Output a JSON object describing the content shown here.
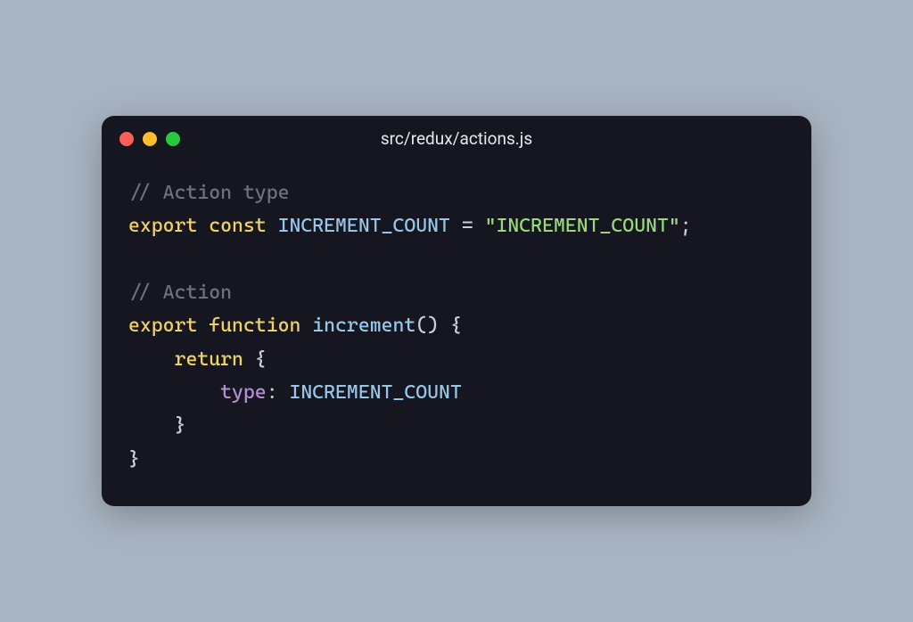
{
  "window": {
    "title": "src/redux/actions.js",
    "trafficLights": {
      "red": "#ff5f56",
      "yellow": "#ffbd2e",
      "green": "#27c93f"
    }
  },
  "code": {
    "comment1": "// Action type",
    "line2": {
      "kw_export": "export",
      "kw_const": "const",
      "ident": "INCREMENT_COUNT",
      "eq": " = ",
      "string": "\"INCREMENT_COUNT\"",
      "semi": ";"
    },
    "comment2": "// Action",
    "line4": {
      "kw_export": "export",
      "kw_function": "function",
      "fn_name": "increment",
      "parens": "()",
      "brace_open": " {"
    },
    "line5": {
      "indent": "    ",
      "kw_return": "return",
      "brace_open": " {"
    },
    "line6": {
      "indent": "        ",
      "prop": "type",
      "colon": ": ",
      "value": "INCREMENT_COUNT"
    },
    "line7": {
      "indent": "    ",
      "brace_close": "}"
    },
    "line8": {
      "brace_close": "}"
    }
  }
}
